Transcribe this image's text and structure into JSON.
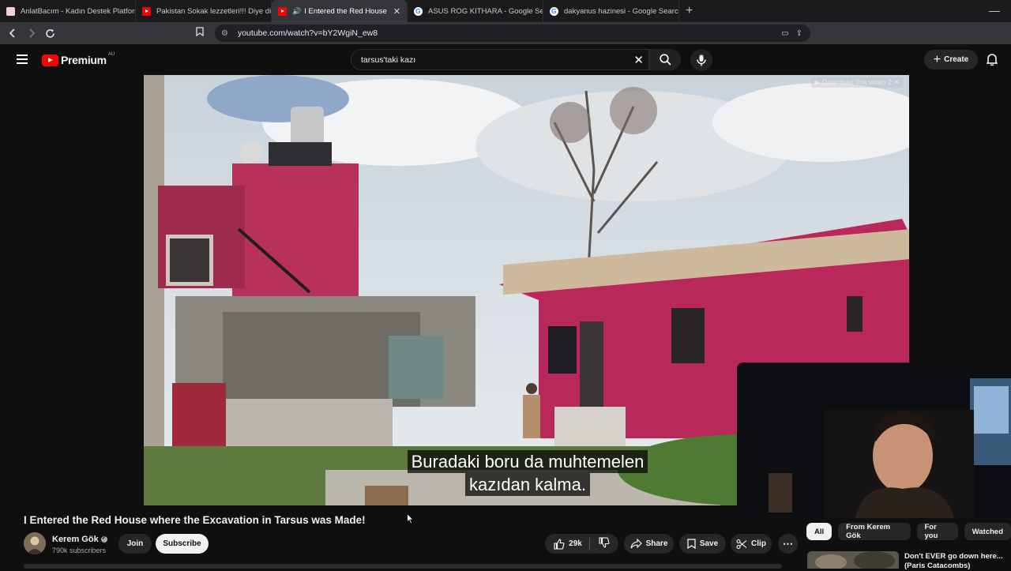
{
  "browser": {
    "tabs": [
      {
        "label": "AnlatBacım - Kadın Destek Platformu",
        "favicon": "pink-favicon",
        "active": false
      },
      {
        "label": "Pakistan Sokak lezzetleri!!! Diye diye",
        "favicon": "youtube-favicon",
        "active": false
      },
      {
        "label": "I Entered the Red House whe",
        "favicon": "youtube-favicon",
        "active": true,
        "close": "✕"
      },
      {
        "label": "ASUS ROG KITHARA - Google Search",
        "favicon": "google-favicon",
        "active": false
      },
      {
        "label": "dakyanus hazinesi - Google Search",
        "favicon": "google-favicon",
        "active": false
      }
    ],
    "new_tab": "+",
    "url": "youtube.com/watch?v=bY2WgiN_ew8"
  },
  "masthead": {
    "logo_text": "Premium",
    "country": "AU",
    "search_query": "tarsus'taki kazı",
    "create_label": "Create"
  },
  "player": {
    "download_overlay": "▶ Download this video",
    "download_overlay_extra": "2 ✕",
    "caption_line1": "Buradaki boru da muhtemelen",
    "caption_line2": "kazıdan kalma."
  },
  "video": {
    "title": "I Entered the Red House where the Excavation in Tarsus was Made!",
    "channel": "Kerem Gök",
    "subscribers": "790k subscribers",
    "join_label": "Join",
    "subscribe_label": "Subscribe",
    "like_count": "29k",
    "share_label": "Share",
    "save_label": "Save",
    "clip_label": "Clip"
  },
  "sidebar": {
    "chips": [
      {
        "label": "All",
        "selected": true
      },
      {
        "label": "From Kerem Gök",
        "selected": false
      },
      {
        "label": "For you",
        "selected": false
      },
      {
        "label": "Watched",
        "selected": false
      }
    ],
    "first_rec_title": "Don't EVER go down here... (Paris Catacombs)"
  },
  "colors": {
    "background": "#0f0f0f",
    "youtube_red": "#ff0000",
    "chip_selected": "#f1f1f1",
    "house_pink": "#b8285a"
  }
}
